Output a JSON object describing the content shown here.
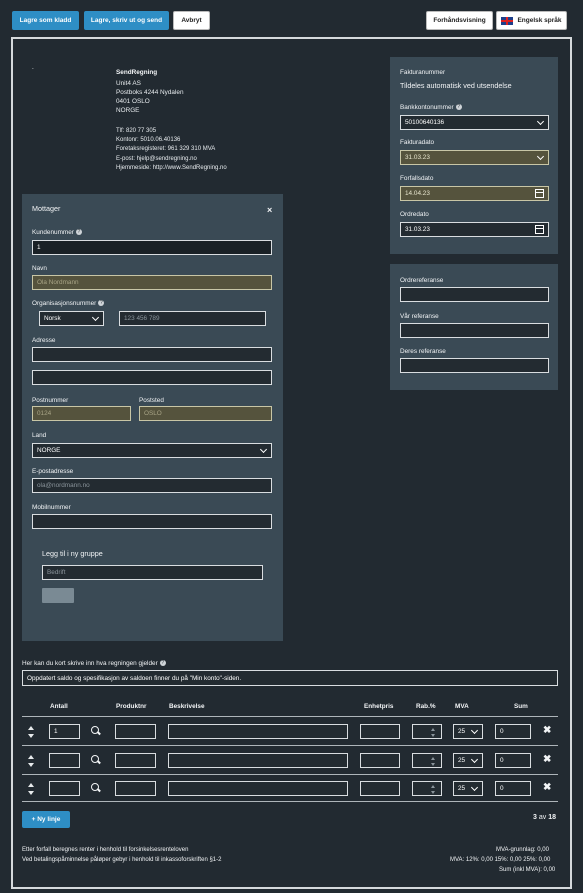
{
  "toolbar": {
    "save_draft": "Lagre som kladd",
    "save_print_send": "Lagre, skriv ut og send",
    "cancel": "Avbryt",
    "preview": "Forhåndsvisning",
    "language": "Engelsk språk"
  },
  "sender": {
    "dot": ".",
    "name": "SendRegning",
    "address_lines": [
      "Unit4 AS",
      "Postboks 4244 Nydalen",
      "0401 OSLO",
      "NORGE"
    ],
    "contact_lines": [
      "Tlf: 820 77 305",
      "Kontonr: 5010.06.40136",
      "Foretaksregisteret: 961 329 310 MVA",
      "E-post: hjelp@sendregning.no",
      "Hjemmeside: http://www.SendRegning.no"
    ]
  },
  "invoice": {
    "number_label": "Fakturanummer",
    "number_value": "Tildeles automatisk ved utsendelse",
    "bank_label": "Bankkontonummer",
    "bank_value": "50100640136",
    "date_label": "Fakturadato",
    "date_value": "31.03.23",
    "due_label": "Forfallsdato",
    "due_value": "14.04.23",
    "order_date_label": "Ordredato",
    "order_date_value": "31.03.23"
  },
  "references": {
    "order_ref_label": "Ordrereferanse",
    "our_ref_label": "Vår referanse",
    "their_ref_label": "Deres referanse"
  },
  "recipient": {
    "title": "Mottager",
    "close": "×",
    "customer_no_label": "Kundenummer",
    "customer_no_value": "1",
    "name_label": "Navn",
    "name_placeholder": "Ola Nordmann",
    "org_label": "Organisasjonsnummer",
    "org_country": "Norsk",
    "org_placeholder": "123 456 789",
    "address_label": "Adresse",
    "postnr_label": "Postnummer",
    "postnr_placeholder": "0124",
    "poststed_label": "Poststed",
    "poststed_placeholder": "OSLO",
    "country_label": "Land",
    "country_value": "NORGE",
    "email_label": "E-postadresse",
    "email_placeholder": "ola@nordmann.no",
    "mobile_label": "Mobilnummer",
    "group_label": "Legg til i ny gruppe",
    "group_placeholder": "Bedrift"
  },
  "description": {
    "label": "Her kan du kort skrive inn hva regningen gjelder",
    "value": "Oppdatert saldo og spesifikasjon av saldoen finner du på \"Min konto\"-siden."
  },
  "lines_table": {
    "headers": {
      "qty": "Antall",
      "product": "Produktnr",
      "desc": "Beskrivelse",
      "unit_price": "Enhetpris",
      "discount": "Rab.%",
      "vat": "MVA",
      "sum": "Sum"
    },
    "rows": [
      {
        "qty": "1",
        "vat": "25",
        "sum": "0"
      },
      {
        "qty": "",
        "vat": "25",
        "sum": "0"
      },
      {
        "qty": "",
        "vat": "25",
        "sum": "0"
      }
    ],
    "new_line": "+ Ny linje",
    "count_current": "3",
    "count_of": "av",
    "count_total": "18"
  },
  "footer": {
    "note1": "Etter forfall beregnes renter i henhold til forsinkelsesrenteloven",
    "note2": "Ved betalingspåminnelse påløper gebyr i henhold til inkassoforskriften §1-2",
    "vat_base": "MVA-grunnlag: 0,00",
    "vat_breakdown": "MVA:  12%: 0,00 15%: 0,00 25%: 0,00",
    "total": "Sum (inkl MVA): 0,00"
  },
  "colors": {
    "background": "#222a31",
    "panel": "#3a4a55",
    "accent": "#2e8ec5",
    "autofill": "#55533d"
  }
}
